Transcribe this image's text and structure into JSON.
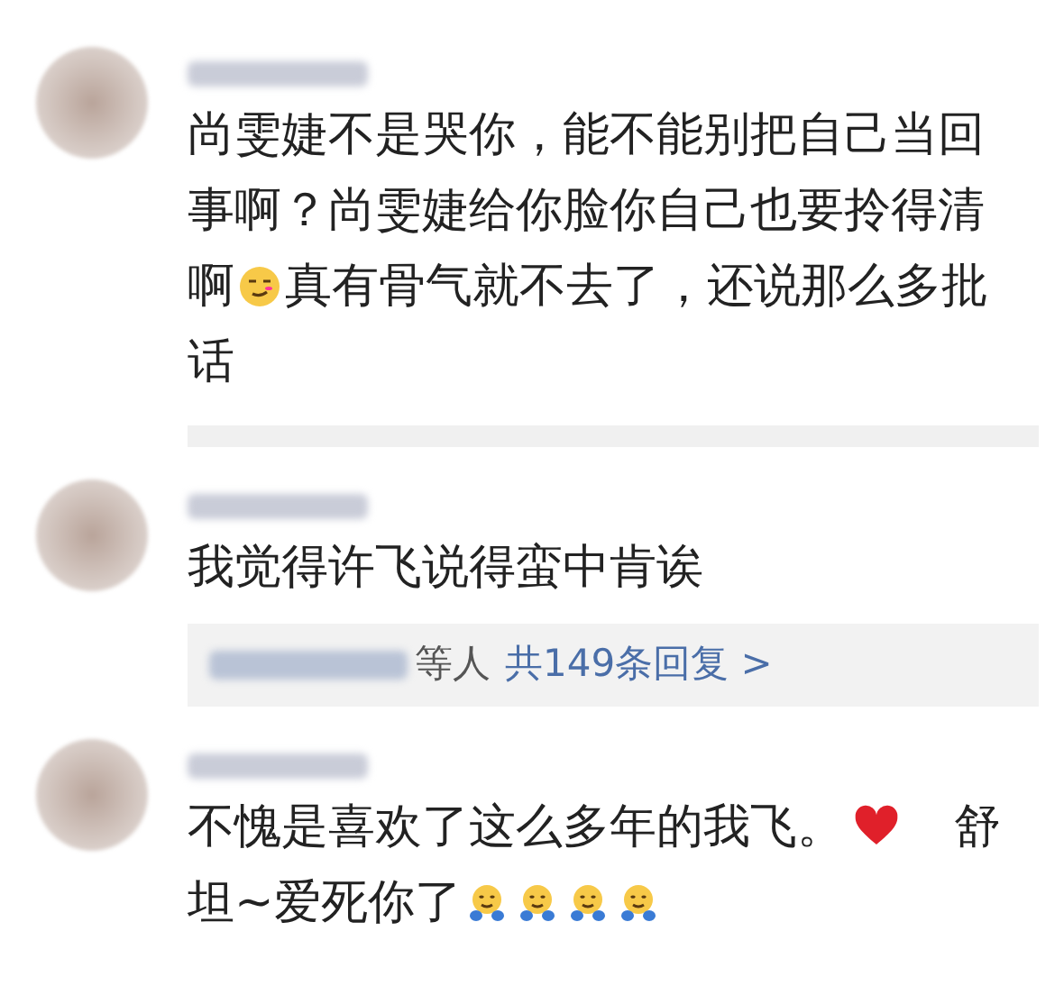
{
  "comments": [
    {
      "segments": [
        {
          "kind": "text",
          "text": "尚雯婕不是哭你，能不能别把自己当回事啊？尚雯婕给你脸你自己也要拎得清啊"
        },
        {
          "kind": "smirk"
        },
        {
          "kind": "text",
          "text": "真有骨气就不去了，还说那么多批话"
        }
      ]
    },
    {
      "segments": [
        {
          "kind": "text",
          "text": "我觉得许飞说得蛮中肯诶"
        }
      ],
      "replies": {
        "suffix": "等人",
        "count": "共149条回复",
        "arrow": ">"
      }
    },
    {
      "segments": [
        {
          "kind": "text",
          "text": "不愧是喜欢了这么多年的我飞。"
        },
        {
          "kind": "heart"
        },
        {
          "kind": "text",
          "text": "   舒坦~爱死你了"
        },
        {
          "kind": "hug"
        },
        {
          "kind": "hug"
        },
        {
          "kind": "hug"
        },
        {
          "kind": "hug"
        }
      ]
    }
  ]
}
